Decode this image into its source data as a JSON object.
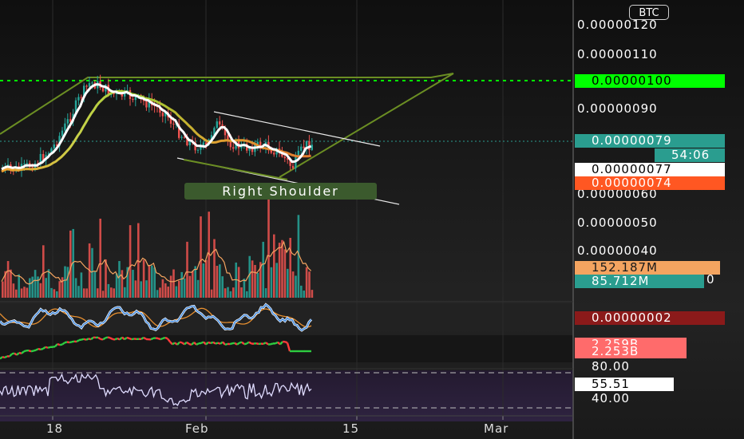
{
  "header": {
    "currency_button": "BTC"
  },
  "price_axis": {
    "labels": [
      "0.00000120",
      "0.00000110",
      "0.00000090",
      "0.00000060",
      "0.00000050",
      "0.00000040"
    ],
    "vol_zero": "0"
  },
  "tags": {
    "dotted_level": {
      "text": "0.00000100",
      "bg": "#00ff00",
      "color": "#000000"
    },
    "last_price": {
      "text": "0.00000079",
      "bg": "#2a9d8f",
      "color": "#ffffff"
    },
    "countdown": {
      "text": "54:06",
      "bg": "#2a9d8f",
      "color": "#ffffff"
    },
    "white_ma": {
      "text": "0.00000077",
      "bg": "#ffffff",
      "color": "#000000"
    },
    "orange_ma": {
      "text": "0.00000074",
      "bg": "#ff5722",
      "color": "#ffffff"
    },
    "volume_ma": {
      "text": "152.187M",
      "bg": "#f4a460",
      "color": "#1a1a1a"
    },
    "volume": {
      "text": "85.712M",
      "bg": "#2a9d8f",
      "color": "#ffffff"
    },
    "stoch": {
      "text": "0.00000002",
      "bg": "#8b1a1a",
      "color": "#ffffff"
    },
    "obv_1": {
      "text": "2.259B",
      "bg": "#ff6b6b",
      "color": "#ffffff"
    },
    "obv_2": {
      "text": "2.253B",
      "bg": "#ff6b6b",
      "color": "#ffffff"
    },
    "rsi_upper": {
      "text": "80.00",
      "bg": "transparent",
      "color": "#ffffff"
    },
    "rsi_value": {
      "text": "55.51",
      "bg": "#ffffff",
      "color": "#000000"
    },
    "rsi_lower": {
      "text": "40.00",
      "bg": "transparent",
      "color": "#ffffff"
    }
  },
  "annotation": {
    "text": "Right Shoulder"
  },
  "time_axis": {
    "labels": [
      "18",
      "Feb",
      "15",
      "Mar"
    ]
  },
  "colors": {
    "up": "#26a69a",
    "down": "#ef5350",
    "level": "#00ff00",
    "trend": "#6b8e23",
    "rsi": "#e0dcff",
    "rsi_bg": "#2a1f3a"
  }
}
